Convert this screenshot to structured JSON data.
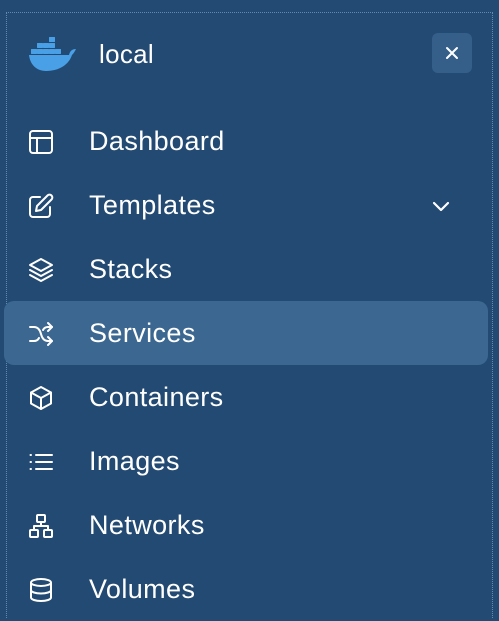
{
  "environment": {
    "name": "local",
    "logo_icon": "docker-whale-icon",
    "close_icon": "close-icon"
  },
  "colors": {
    "background": "#234a72",
    "active_item": "#3b6790",
    "close_button": "#355f89",
    "docker_blue": "#4aa0e6",
    "text": "#ffffff"
  },
  "nav": {
    "items": [
      {
        "label": "Dashboard",
        "icon": "layout-icon",
        "active": false
      },
      {
        "label": "Templates",
        "icon": "edit-icon",
        "active": false,
        "expandable": true
      },
      {
        "label": "Stacks",
        "icon": "layers-icon",
        "active": false
      },
      {
        "label": "Services",
        "icon": "shuffle-icon",
        "active": true
      },
      {
        "label": "Containers",
        "icon": "box-icon",
        "active": false
      },
      {
        "label": "Images",
        "icon": "list-icon",
        "active": false
      },
      {
        "label": "Networks",
        "icon": "network-icon",
        "active": false
      },
      {
        "label": "Volumes",
        "icon": "database-icon",
        "active": false
      }
    ]
  }
}
